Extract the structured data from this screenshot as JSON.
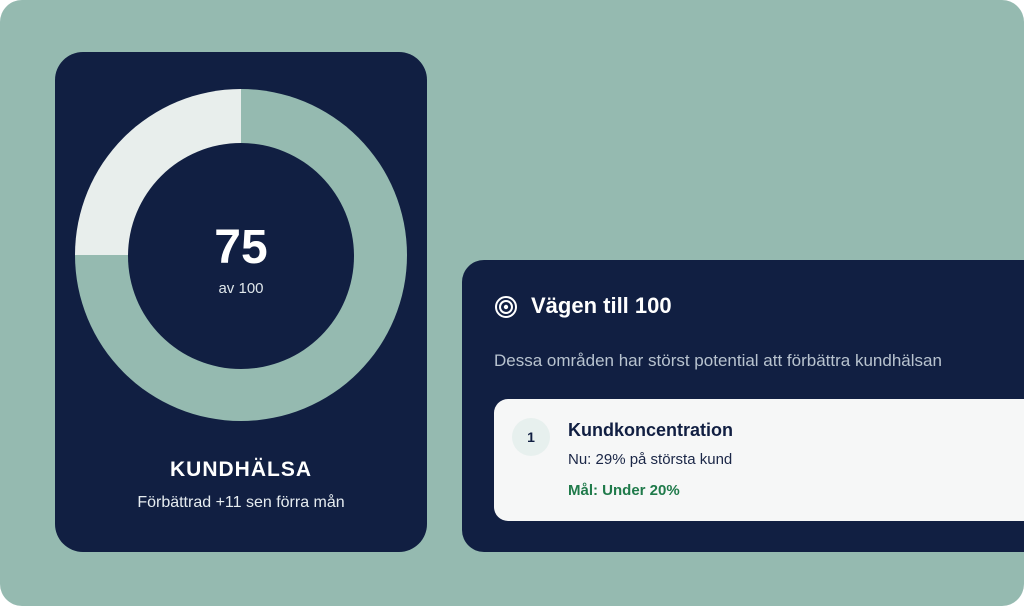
{
  "colors": {
    "background": "#95bab0",
    "card": "#111f42",
    "gauge_fill": "#95bab0",
    "gauge_track": "#e8eeec",
    "goal_text": "#1f7a4a"
  },
  "health": {
    "score": "75",
    "max_label": "av 100",
    "score_fraction": 0.75,
    "title": "KUNDHÄLSA",
    "change_text": "Förbättrad +11 sen förra mån"
  },
  "road": {
    "icon": "target-icon",
    "title": "Vägen till 100",
    "description": "Dessa områden har störst potential att förbättra kundhälsan",
    "items": [
      {
        "number": "1",
        "title": "Kundkoncentration",
        "current": "Nu: 29% på största kund",
        "goal": "Mål: Under 20%"
      }
    ]
  }
}
